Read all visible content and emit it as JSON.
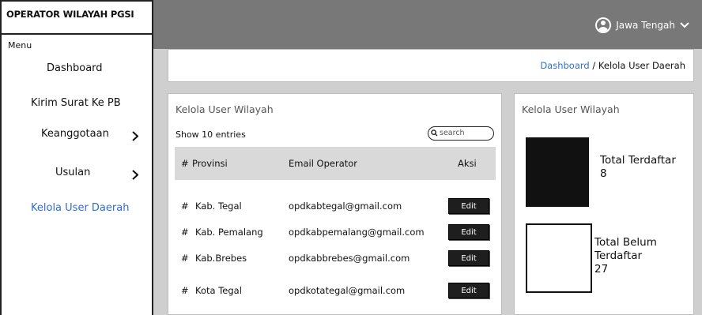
{
  "sidebar": {
    "brand": "OPERATOR WILAYAH PGSI",
    "menu_label": "Menu",
    "items": [
      {
        "label": "Dashboard"
      },
      {
        "label": "Kirim Surat Ke PB"
      },
      {
        "label": "Keanggotaan"
      },
      {
        "label": "Usulan"
      },
      {
        "label": "Kelola User Daerah"
      }
    ]
  },
  "topbar": {
    "user_label": "Jawa Tengah"
  },
  "breadcrumb": {
    "link": "Dashboard",
    "separator": " / ",
    "current": "Kelola User Daerah"
  },
  "table_panel": {
    "title": "Kelola User Wilayah",
    "show_entries": "Show 10 entries",
    "search_placeholder": "search",
    "columns": [
      "#",
      "Provinsi",
      "Email Operator",
      "Aksi"
    ],
    "rows": [
      {
        "num": "#",
        "provinsi": "Kab. Tegal",
        "email": "opdkabtegal@gmail.com",
        "action": "Edit"
      },
      {
        "num": "#",
        "provinsi": "Kab. Pemalang",
        "email": "opdkabpemalang@gmail.com",
        "action": "Edit"
      },
      {
        "num": "#",
        "provinsi": "Kab.Brebes",
        "email": "opdkabbrebes@gmail.com",
        "action": "Edit"
      },
      {
        "num": "#",
        "provinsi": "Kota Tegal",
        "email": "opdkotategal@gmail.com",
        "action": "Edit"
      }
    ]
  },
  "stats_panel": {
    "title": "Kelola User Wilayah",
    "registered": {
      "label": "Total Terdaftar",
      "value": "8"
    },
    "unregistered": {
      "label_line1": "Total Belum",
      "label_line2": "Terdaftar",
      "value": "27"
    }
  },
  "colors": {
    "topbar": "#787878",
    "content_bg": "#cfcfcf",
    "link": "#2f6fd0",
    "filled_box": "#111111"
  }
}
